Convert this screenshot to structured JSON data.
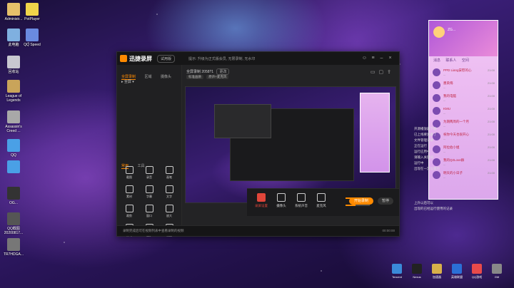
{
  "desktop": {
    "icons": [
      {
        "label": "Administr...",
        "color": "#e6c06a"
      },
      {
        "label": "PotPlayer",
        "color": "#f0d44a"
      },
      {
        "label": "此电脑",
        "color": "#7fb0e0"
      },
      {
        "label": "QQ Speed",
        "color": "#6a8ae0"
      },
      {
        "label": "回收站",
        "color": "#c8c8d0"
      },
      {
        "label": "League of Legends",
        "color": "#c9a45a"
      },
      {
        "label": "Assassin's Creed ...",
        "color": "#a8a8a8"
      },
      {
        "label": "QQ",
        "color": "#4aa0e6"
      },
      {
        "label": "OG...",
        "color": "#333"
      },
      {
        "label": "QQ截图 20200817...",
        "color": "#555"
      },
      {
        "label": "TR7HDGA...",
        "color": "#777"
      }
    ]
  },
  "recorder": {
    "brand": "迅捷录屏",
    "version": "试用版",
    "notice": "提示: 升级为正式版会员, 无限录制, 无水印",
    "tabs": [
      "全屏录制",
      "区域",
      "摄像头"
    ],
    "area_select": "全屏",
    "tool_tabs": [
      "常用",
      "工具"
    ],
    "tools": [
      "截图",
      "录音",
      "画笔",
      "素材",
      "字幕",
      "文字",
      "裁剪",
      "窗口",
      "放大",
      "计时",
      "更多",
      "设置"
    ],
    "main_head": "全屏录制 2058?1",
    "main_head_pill": "更改",
    "main_sub": [
      "标准画质",
      "原声+麦克风"
    ],
    "bottom": {
      "record": "录屏设置",
      "b2": "摄像头",
      "b3": "系统声音",
      "b4": "麦克风",
      "start": "开始录制",
      "secondary": "暂停"
    },
    "volume_levels": [
      0.65,
      0.4
    ],
    "status_msg": "录制完成后可在视频列表中查看录制的视频",
    "status_right": "00:00:00"
  },
  "chat": {
    "header_name": "ZG...",
    "tabs": [
      "消息",
      "联系人",
      "空间"
    ],
    "items": [
      {
        "name": "PPD Liang安慰的心",
        "time": "21:00",
        "preview": "..."
      },
      {
        "name": "墨染殇",
        "time": "21:00",
        "preview": "..."
      },
      {
        "name": "我的电脑",
        "time": "21:00",
        "preview": "..."
      },
      {
        "name": "KMU",
        "time": "21:00",
        "preview": "..."
      },
      {
        "name": "为期两周的一个月",
        "time": "21:00",
        "preview": "..."
      },
      {
        "name": "祝你今天也很开心",
        "time": "21:00",
        "preview": "..."
      },
      {
        "name": "阿拉伯小姐",
        "time": "21:00",
        "preview": "..."
      },
      {
        "name": "我的Q2Love群",
        "time": "21:00",
        "preview": "..."
      },
      {
        "name": "明天的小日子",
        "time": "21:00",
        "preview": "..."
      }
    ]
  },
  "side_text": [
    "开源播放器下载",
    "已上线要准备了",
    "文件管理记录",
    "正在运行",
    "运行应用中",
    "请输入关键词",
    "运行中",
    "出现在一定设置的",
    "上升以后可以",
    "出现的已经运行使用的记录"
  ],
  "tray": [
    {
      "label": "Tencent",
      "color": "#3a8ad8"
    },
    {
      "label": "Nexus",
      "color": "#222"
    },
    {
      "label": "加速器",
      "color": "#d8b04a"
    },
    {
      "label": "英雄联盟",
      "color": "#2b6fd6"
    },
    {
      "label": "QQ游戏",
      "color": "#e84a4a"
    },
    {
      "label": "GM",
      "color": "#888"
    }
  ]
}
